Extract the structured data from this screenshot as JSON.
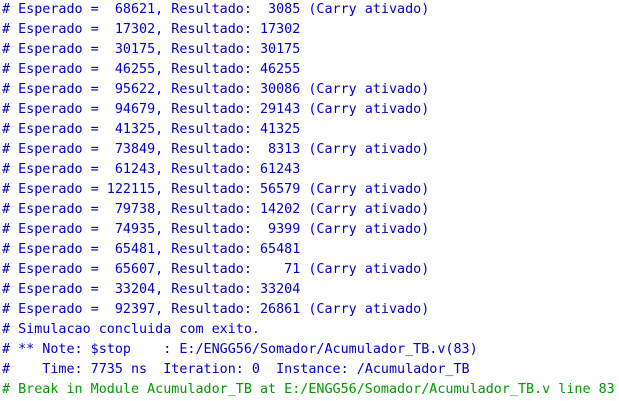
{
  "console": {
    "lines": [
      {
        "text": "# Esperado =  68621, Resultado:  3085 (Carry ativado)",
        "kind": "output"
      },
      {
        "text": "# Esperado =  17302, Resultado: 17302",
        "kind": "output"
      },
      {
        "text": "# Esperado =  30175, Resultado: 30175",
        "kind": "output"
      },
      {
        "text": "# Esperado =  46255, Resultado: 46255",
        "kind": "output"
      },
      {
        "text": "# Esperado =  95622, Resultado: 30086 (Carry ativado)",
        "kind": "output"
      },
      {
        "text": "# Esperado =  94679, Resultado: 29143 (Carry ativado)",
        "kind": "output"
      },
      {
        "text": "# Esperado =  41325, Resultado: 41325",
        "kind": "output"
      },
      {
        "text": "# Esperado =  73849, Resultado:  8313 (Carry ativado)",
        "kind": "output"
      },
      {
        "text": "# Esperado =  61243, Resultado: 61243",
        "kind": "output"
      },
      {
        "text": "# Esperado = 122115, Resultado: 56579 (Carry ativado)",
        "kind": "output"
      },
      {
        "text": "# Esperado =  79738, Resultado: 14202 (Carry ativado)",
        "kind": "output"
      },
      {
        "text": "# Esperado =  74935, Resultado:  9399 (Carry ativado)",
        "kind": "output"
      },
      {
        "text": "# Esperado =  65481, Resultado: 65481",
        "kind": "output"
      },
      {
        "text": "# Esperado =  65607, Resultado:    71 (Carry ativado)",
        "kind": "output"
      },
      {
        "text": "# Esperado =  33204, Resultado: 33204",
        "kind": "output"
      },
      {
        "text": "# Esperado =  92397, Resultado: 26861 (Carry ativado)",
        "kind": "output"
      },
      {
        "text": "# Simulacao concluida com exito.",
        "kind": "output"
      },
      {
        "text": "# ** Note: $stop    : E:/ENGG56/Somador/Acumulador_TB.v(83)",
        "kind": "output"
      },
      {
        "text": "#    Time: 7735 ns  Iteration: 0  Instance: /Acumulador_TB",
        "kind": "output"
      },
      {
        "text": "# Break in Module Acumulador_TB at E:/ENGG56/Somador/Acumulador_TB.v line 83",
        "kind": "break"
      }
    ]
  },
  "colors": {
    "output_text": "#0000d0",
    "break_text": "#009a00",
    "background": "#ffffff"
  }
}
